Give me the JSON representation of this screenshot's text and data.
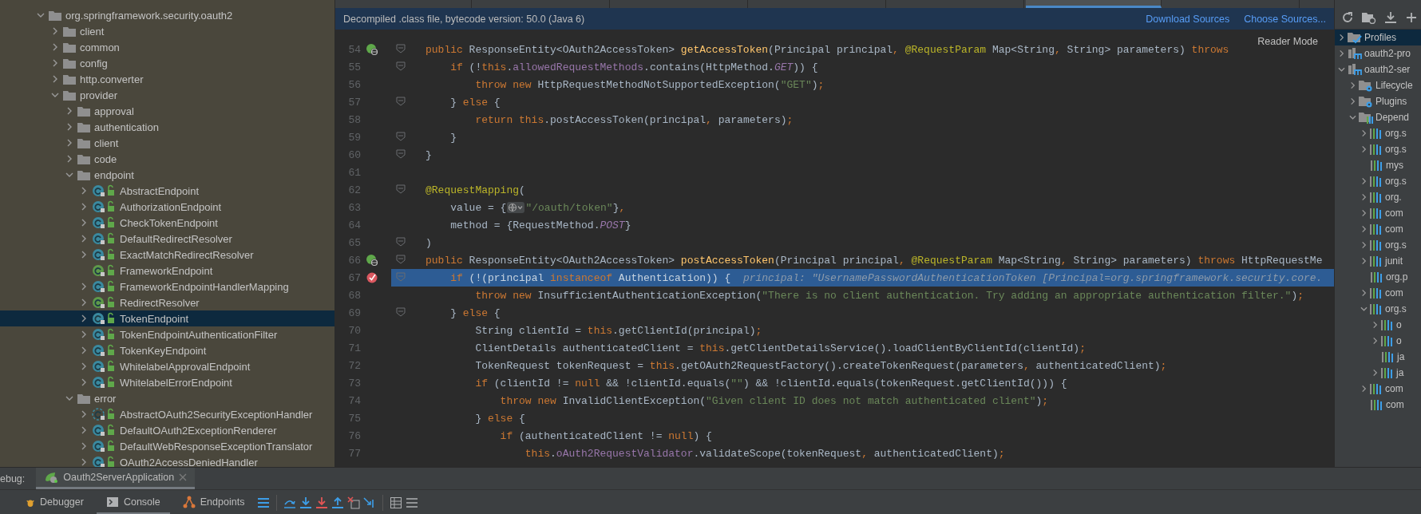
{
  "editor_tabs": [
    {
      "selected": false
    },
    {
      "selected": false
    },
    {
      "selected": false
    },
    {
      "selected": false
    },
    {
      "selected": false
    },
    {
      "selected": true
    },
    {
      "selected": false
    }
  ],
  "project_tree": [
    {
      "label": "org.springframework.security.oauth2",
      "kind": "folder",
      "expanded": true,
      "selected": false,
      "children": [
        {
          "label": "client",
          "kind": "folder",
          "expanded": false,
          "selected": false
        },
        {
          "label": "common",
          "kind": "folder",
          "expanded": false,
          "selected": false
        },
        {
          "label": "config",
          "kind": "folder",
          "expanded": false,
          "selected": false
        },
        {
          "label": "http.converter",
          "kind": "folder",
          "expanded": false,
          "selected": false
        },
        {
          "label": "provider",
          "kind": "folder",
          "expanded": true,
          "selected": false,
          "children": [
            {
              "label": "approval",
              "kind": "folder",
              "expanded": false,
              "selected": false
            },
            {
              "label": "authentication",
              "kind": "folder",
              "expanded": false,
              "selected": false
            },
            {
              "label": "client",
              "kind": "folder",
              "expanded": false,
              "selected": false
            },
            {
              "label": "code",
              "kind": "folder",
              "expanded": false,
              "selected": false
            },
            {
              "label": "endpoint",
              "kind": "folder",
              "expanded": true,
              "selected": false,
              "children": [
                {
                  "label": "AbstractEndpoint",
                  "kind": "class",
                  "expanded": false,
                  "selected": false
                },
                {
                  "label": "AuthorizationEndpoint",
                  "kind": "class",
                  "expanded": false,
                  "selected": false
                },
                {
                  "label": "CheckTokenEndpoint",
                  "kind": "class",
                  "expanded": false,
                  "selected": false
                },
                {
                  "label": "DefaultRedirectResolver",
                  "kind": "class",
                  "expanded": false,
                  "selected": false
                },
                {
                  "label": "ExactMatchRedirectResolver",
                  "kind": "class",
                  "expanded": false,
                  "selected": false
                },
                {
                  "label": "FrameworkEndpoint",
                  "kind": "annotation",
                  "selected": false
                },
                {
                  "label": "FrameworkEndpointHandlerMapping",
                  "kind": "class",
                  "expanded": false,
                  "selected": false
                },
                {
                  "label": "RedirectResolver",
                  "kind": "interface",
                  "expanded": false,
                  "selected": false
                },
                {
                  "label": "TokenEndpoint",
                  "kind": "class",
                  "expanded": false,
                  "selected": true
                },
                {
                  "label": "TokenEndpointAuthenticationFilter",
                  "kind": "class",
                  "expanded": false,
                  "selected": false
                },
                {
                  "label": "TokenKeyEndpoint",
                  "kind": "class",
                  "expanded": false,
                  "selected": false
                },
                {
                  "label": "WhitelabelApprovalEndpoint",
                  "kind": "class",
                  "expanded": false,
                  "selected": false
                },
                {
                  "label": "WhitelabelErrorEndpoint",
                  "kind": "class",
                  "expanded": false,
                  "selected": false
                }
              ]
            },
            {
              "label": "error",
              "kind": "folder",
              "expanded": true,
              "selected": false,
              "children": [
                {
                  "label": "AbstractOAuth2SecurityExceptionHandler",
                  "kind": "abstract",
                  "expanded": false,
                  "selected": false
                },
                {
                  "label": "DefaultOAuth2ExceptionRenderer",
                  "kind": "class",
                  "expanded": false,
                  "selected": false
                },
                {
                  "label": "DefaultWebResponseExceptionTranslator",
                  "kind": "class",
                  "expanded": false,
                  "selected": false
                },
                {
                  "label": "OAuth2AccessDeniedHandler",
                  "kind": "class",
                  "expanded": false,
                  "selected": false
                }
              ]
            }
          ]
        }
      ]
    }
  ],
  "banner": {
    "text": "Decompiled .class file, bytecode version: 50.0 (Java 6)",
    "links": [
      "Download Sources",
      "Choose Sources..."
    ]
  },
  "reader_mode": "Reader Mode",
  "code_lines": [
    {
      "number": "54",
      "kind": "override",
      "fold": true,
      "current": false,
      "tokens": [
        {
          "kind": "k",
          "text": "public"
        },
        {
          "kind": "p",
          "text": " ResponseEntity<OAuth2AccessToken> "
        },
        {
          "kind": "f",
          "text": "getAccessToken"
        },
        {
          "kind": "p",
          "text": "(Principal principal"
        },
        {
          "kind": "k",
          "text": ", "
        },
        {
          "kind": "a",
          "text": "@RequestParam"
        },
        {
          "kind": "p",
          "text": " Map<String"
        },
        {
          "kind": "k",
          "text": ", "
        },
        {
          "kind": "p",
          "text": "String> parameters) "
        },
        {
          "kind": "k",
          "text": "throws"
        }
      ]
    },
    {
      "number": "55",
      "kind": "plain",
      "fold": true,
      "current": false,
      "tokens": [
        {
          "kind": "k",
          "text": "    if"
        },
        {
          "kind": "p",
          "text": " (!"
        },
        {
          "kind": "k",
          "text": "this"
        },
        {
          "kind": "p",
          "text": "."
        },
        {
          "kind": "v",
          "text": "allowedRequestMethods"
        },
        {
          "kind": "p",
          "text": ".contains(HttpMethod."
        },
        {
          "kind": "c",
          "text": "GET"
        },
        {
          "kind": "p",
          "text": ")) {"
        }
      ]
    },
    {
      "number": "56",
      "kind": "plain",
      "fold": false,
      "current": false,
      "tokens": [
        {
          "kind": "k",
          "text": "        throw new"
        },
        {
          "kind": "p",
          "text": " HttpRequestMethodNotSupportedException("
        },
        {
          "kind": "s",
          "text": "\"GET\""
        },
        {
          "kind": "p",
          "text": ")"
        },
        {
          "kind": "k",
          "text": ";"
        }
      ]
    },
    {
      "number": "57",
      "kind": "plain",
      "fold": true,
      "current": false,
      "tokens": [
        {
          "kind": "p",
          "text": "    } "
        },
        {
          "kind": "k",
          "text": "else"
        },
        {
          "kind": "p",
          "text": " {"
        }
      ]
    },
    {
      "number": "58",
      "kind": "plain",
      "fold": false,
      "current": false,
      "tokens": [
        {
          "kind": "k",
          "text": "        return this"
        },
        {
          "kind": "p",
          "text": ".postAccessToken(principal"
        },
        {
          "kind": "k",
          "text": ", "
        },
        {
          "kind": "p",
          "text": "parameters)"
        },
        {
          "kind": "k",
          "text": ";"
        }
      ]
    },
    {
      "number": "59",
      "kind": "plain",
      "fold": true,
      "current": false,
      "tokens": [
        {
          "kind": "p",
          "text": "    }"
        }
      ]
    },
    {
      "number": "60",
      "kind": "plain",
      "fold": true,
      "current": false,
      "tokens": [
        {
          "kind": "p",
          "text": "}"
        }
      ]
    },
    {
      "number": "61",
      "kind": "plain",
      "fold": false,
      "current": false
    },
    {
      "number": "62",
      "kind": "plain",
      "fold": true,
      "current": false,
      "tokens": [
        {
          "kind": "a",
          "text": "@RequestMapping"
        },
        {
          "kind": "p",
          "text": "("
        }
      ]
    },
    {
      "number": "63",
      "kind": "plain",
      "fold": false,
      "current": false,
      "tokens": [
        {
          "kind": "p",
          "text": "    value = {"
        },
        {
          "kind": "g"
        },
        {
          "kind": "s",
          "text": "\"/oauth/token\""
        },
        {
          "kind": "p",
          "text": "}"
        },
        {
          "kind": "k",
          "text": ","
        }
      ]
    },
    {
      "number": "64",
      "kind": "plain",
      "fold": false,
      "current": false,
      "tokens": [
        {
          "kind": "p",
          "text": "    method = {RequestMethod."
        },
        {
          "kind": "c",
          "text": "POST"
        },
        {
          "kind": "p",
          "text": "}"
        }
      ]
    },
    {
      "number": "65",
      "kind": "plain",
      "fold": true,
      "current": false,
      "tokens": [
        {
          "kind": "p",
          "text": ")"
        }
      ]
    },
    {
      "number": "66",
      "kind": "override",
      "fold": true,
      "current": false,
      "tokens": [
        {
          "kind": "k",
          "text": "public"
        },
        {
          "kind": "p",
          "text": " ResponseEntity<OAuth2AccessToken> "
        },
        {
          "kind": "f",
          "text": "postAccessToken"
        },
        {
          "kind": "p",
          "text": "(Principal principal"
        },
        {
          "kind": "k",
          "text": ", "
        },
        {
          "kind": "a",
          "text": "@RequestParam"
        },
        {
          "kind": "p",
          "text": " Map<String"
        },
        {
          "kind": "k",
          "text": ", "
        },
        {
          "kind": "p",
          "text": "String> parameters) "
        },
        {
          "kind": "k",
          "text": "throws"
        },
        {
          "kind": "p",
          "text": " HttpRequestMe"
        }
      ]
    },
    {
      "number": "67",
      "kind": "breakpoint",
      "fold": true,
      "current": true,
      "tokens": [
        {
          "kind": "k",
          "text": "    if"
        },
        {
          "kind": "p",
          "text": " (!(principal "
        },
        {
          "kind": "k",
          "text": "instanceof"
        },
        {
          "kind": "p",
          "text": " Authentication)) {"
        },
        {
          "kind": "h",
          "text": "  principal: \"UsernamePasswordAuthenticationToken [Principal=org.springframework.security.core."
        }
      ]
    },
    {
      "number": "68",
      "kind": "plain",
      "fold": false,
      "current": false,
      "tokens": [
        {
          "kind": "k",
          "text": "        throw new"
        },
        {
          "kind": "p",
          "text": " InsufficientAuthenticationException("
        },
        {
          "kind": "s",
          "text": "\"There is no client authentication. Try adding an appropriate authentication filter.\""
        },
        {
          "kind": "p",
          "text": ")"
        },
        {
          "kind": "k",
          "text": ";"
        }
      ]
    },
    {
      "number": "69",
      "kind": "plain",
      "fold": true,
      "current": false,
      "tokens": [
        {
          "kind": "p",
          "text": "    } "
        },
        {
          "kind": "k",
          "text": "else"
        },
        {
          "kind": "p",
          "text": " {"
        }
      ]
    },
    {
      "number": "70",
      "kind": "plain",
      "fold": false,
      "current": false,
      "tokens": [
        {
          "kind": "p",
          "text": "        String clientId = "
        },
        {
          "kind": "k",
          "text": "this"
        },
        {
          "kind": "p",
          "text": ".getClientId(principal)"
        },
        {
          "kind": "k",
          "text": ";"
        }
      ]
    },
    {
      "number": "71",
      "kind": "plain",
      "fold": false,
      "current": false,
      "tokens": [
        {
          "kind": "p",
          "text": "        ClientDetails authenticatedClient = "
        },
        {
          "kind": "k",
          "text": "this"
        },
        {
          "kind": "p",
          "text": ".getClientDetailsService().loadClientByClientId(clientId)"
        },
        {
          "kind": "k",
          "text": ";"
        }
      ]
    },
    {
      "number": "72",
      "kind": "plain",
      "fold": false,
      "current": false,
      "tokens": [
        {
          "kind": "p",
          "text": "        TokenRequest tokenRequest = "
        },
        {
          "kind": "k",
          "text": "this"
        },
        {
          "kind": "p",
          "text": ".getOAuth2RequestFactory().createTokenRequest(parameters"
        },
        {
          "kind": "k",
          "text": ", "
        },
        {
          "kind": "p",
          "text": "authenticatedClient)"
        },
        {
          "kind": "k",
          "text": ";"
        }
      ]
    },
    {
      "number": "73",
      "kind": "plain",
      "fold": false,
      "current": false,
      "tokens": [
        {
          "kind": "k",
          "text": "        if"
        },
        {
          "kind": "p",
          "text": " (clientId != "
        },
        {
          "kind": "k",
          "text": "null"
        },
        {
          "kind": "p",
          "text": " && !clientId.equals("
        },
        {
          "kind": "s",
          "text": "\"\""
        },
        {
          "kind": "p",
          "text": ") && !clientId.equals(tokenRequest.getClientId())) {"
        }
      ]
    },
    {
      "number": "74",
      "kind": "plain",
      "fold": false,
      "current": false,
      "tokens": [
        {
          "kind": "k",
          "text": "            throw new"
        },
        {
          "kind": "p",
          "text": " InvalidClientException("
        },
        {
          "kind": "s",
          "text": "\"Given client ID does not match authenticated client\""
        },
        {
          "kind": "p",
          "text": ")"
        },
        {
          "kind": "k",
          "text": ";"
        }
      ]
    },
    {
      "number": "75",
      "kind": "plain",
      "fold": false,
      "current": false,
      "tokens": [
        {
          "kind": "p",
          "text": "        } "
        },
        {
          "kind": "k",
          "text": "else"
        },
        {
          "kind": "p",
          "text": " {"
        }
      ]
    },
    {
      "number": "76",
      "kind": "plain",
      "fold": false,
      "current": false,
      "tokens": [
        {
          "kind": "k",
          "text": "            if"
        },
        {
          "kind": "p",
          "text": " (authenticatedClient != "
        },
        {
          "kind": "k",
          "text": "null"
        },
        {
          "kind": "p",
          "text": ") {"
        }
      ]
    },
    {
      "number": "77",
      "kind": "plain",
      "fold": false,
      "current": false,
      "tokens": [
        {
          "kind": "k",
          "text": "                this"
        },
        {
          "kind": "p",
          "text": "."
        },
        {
          "kind": "v",
          "text": "oAuth2RequestValidator"
        },
        {
          "kind": "p",
          "text": ".validateScope(tokenRequest"
        },
        {
          "kind": "k",
          "text": ", "
        },
        {
          "kind": "p",
          "text": "authenticatedClient)"
        },
        {
          "kind": "k",
          "text": ";"
        }
      ]
    }
  ],
  "maven_tree": [
    {
      "label": "Profiles",
      "kind": "profiles",
      "expanded": false,
      "selected": true
    },
    {
      "label": "oauth2-pro",
      "kind": "module",
      "expanded": false,
      "selected": false
    },
    {
      "label": "oauth2-ser",
      "kind": "module",
      "expanded": true,
      "selected": false,
      "children": [
        {
          "label": "Lifecycle",
          "kind": "lifecycle",
          "expanded": false,
          "selected": false
        },
        {
          "label": "Plugins",
          "kind": "lifecycle",
          "expanded": false,
          "selected": false
        },
        {
          "label": "Depend",
          "kind": "dependencies",
          "expanded": true,
          "selected": false,
          "children": [
            {
              "label": "org.s",
              "kind": "library",
              "expanded": false,
              "selected": false
            },
            {
              "label": "org.s",
              "kind": "library",
              "expanded": false,
              "selected": false
            },
            {
              "label": "mys",
              "kind": "library",
              "selected": false
            },
            {
              "label": "org.s",
              "kind": "library",
              "expanded": false,
              "selected": false
            },
            {
              "label": "org.",
              "kind": "library",
              "expanded": false,
              "selected": false
            },
            {
              "label": "com",
              "kind": "library",
              "expanded": false,
              "selected": false
            },
            {
              "label": "com",
              "kind": "library",
              "expanded": false,
              "selected": false
            },
            {
              "label": "org.s",
              "kind": "library",
              "expanded": false,
              "selected": false
            },
            {
              "label": "junit",
              "kind": "library",
              "expanded": false,
              "selected": false
            },
            {
              "label": "org.p",
              "kind": "library",
              "selected": false
            },
            {
              "label": "com",
              "kind": "library",
              "expanded": false,
              "selected": false
            },
            {
              "label": "org.s",
              "kind": "library",
              "expanded": true,
              "selected": false,
              "children": [
                {
                  "label": "o",
                  "kind": "library",
                  "expanded": false,
                  "selected": false
                },
                {
                  "label": "o",
                  "kind": "library",
                  "expanded": false,
                  "selected": false
                },
                {
                  "label": "ja",
                  "kind": "library",
                  "selected": false
                },
                {
                  "label": "ja",
                  "kind": "library",
                  "expanded": false,
                  "selected": false
                }
              ]
            },
            {
              "label": "com",
              "kind": "library",
              "expanded": false,
              "selected": false
            },
            {
              "label": "com",
              "kind": "library",
              "selected": false
            }
          ]
        }
      ]
    }
  ],
  "debug": {
    "label": "ebug:",
    "tabs": [
      {
        "label": "Oauth2ServerApplication",
        "selected": true
      }
    ]
  },
  "debug_tabs": [
    {
      "label": "Debugger",
      "kind": "debugger",
      "selected": false
    },
    {
      "label": "Console",
      "kind": "console",
      "selected": true
    },
    {
      "label": "Endpoints",
      "kind": "endpoints",
      "selected": false
    }
  ]
}
